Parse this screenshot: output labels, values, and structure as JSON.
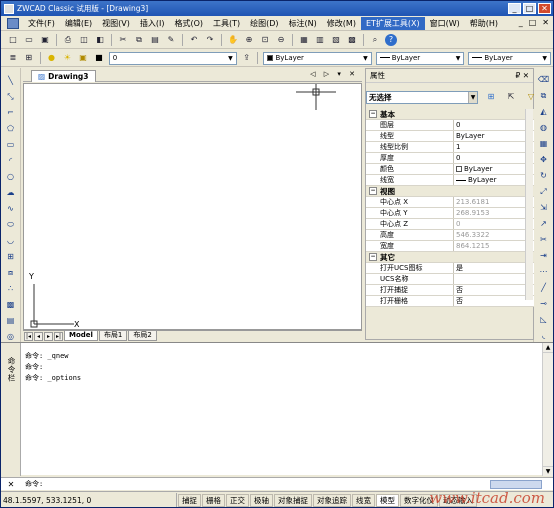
{
  "title": {
    "text": "ZWCAD Classic 试用版 - [Drawing3]",
    "buttons": [
      "_",
      "□",
      "✕"
    ]
  },
  "menubar": {
    "items": [
      {
        "label": "文件(F)"
      },
      {
        "label": "编辑(E)"
      },
      {
        "label": "视图(V)"
      },
      {
        "label": "插入(I)"
      },
      {
        "label": "格式(O)"
      },
      {
        "label": "工具(T)"
      },
      {
        "label": "绘图(D)"
      },
      {
        "label": "标注(N)"
      },
      {
        "label": "修改(M)"
      },
      {
        "label": "ET扩展工具(X)",
        "highlighted": true
      },
      {
        "label": "窗口(W)"
      },
      {
        "label": "帮助(H)"
      }
    ],
    "doc_controls": [
      "_",
      "□",
      "✕"
    ]
  },
  "toolbar2": {
    "layer_value": "0",
    "color_value": "ByLayer",
    "linetype_value": "ByLayer",
    "lineweight_value": "ByLayer"
  },
  "document": {
    "tab_label": "Drawing3",
    "tab_controls": "◁ ▷ ▾ ✕",
    "layout_tabs": [
      "Model",
      "布局1",
      "布局2"
    ],
    "ucs_x_label": "X",
    "ucs_y_label": "Y"
  },
  "properties": {
    "title": "属性",
    "header_controls": "₽ ✕",
    "selection": "无选择",
    "categories": [
      {
        "name": "基本",
        "rows": [
          {
            "key": "图层",
            "value": "0"
          },
          {
            "key": "线型",
            "value": "ByLayer"
          },
          {
            "key": "线型比例",
            "value": "1"
          },
          {
            "key": "厚度",
            "value": "0"
          },
          {
            "key": "颜色",
            "value": "ByLayer",
            "swatch": true
          },
          {
            "key": "线宽",
            "value": "ByLayer",
            "line": true
          }
        ]
      },
      {
        "name": "视图",
        "rows": [
          {
            "key": "中心点 X",
            "value": "213.6181",
            "gray": true
          },
          {
            "key": "中心点 Y",
            "value": "268.9153",
            "gray": true
          },
          {
            "key": "中心点 Z",
            "value": "0",
            "gray": true
          },
          {
            "key": "高度",
            "value": "546.3322",
            "gray": true
          },
          {
            "key": "宽度",
            "value": "864.1215",
            "gray": true
          }
        ]
      },
      {
        "name": "其它",
        "rows": [
          {
            "key": "打开UCS图标",
            "value": "是"
          },
          {
            "key": "UCS名称",
            "value": ""
          },
          {
            "key": "打开捕捉",
            "value": "否"
          },
          {
            "key": "打开栅格",
            "value": "否"
          }
        ]
      }
    ]
  },
  "command": {
    "side_label": "命令栏",
    "history": [
      "命令: _qnew",
      "命令:",
      "命令: _options"
    ],
    "prompt": "命令:"
  },
  "status": {
    "coords": "48.1.5597, 533.1251, 0",
    "buttons": [
      {
        "label": "捕捉",
        "on": false
      },
      {
        "label": "栅格",
        "on": false
      },
      {
        "label": "正交",
        "on": false
      },
      {
        "label": "极轴",
        "on": false
      },
      {
        "label": "对象捕捉",
        "on": false
      },
      {
        "label": "对象追踪",
        "on": false
      },
      {
        "label": "线宽",
        "on": false
      },
      {
        "label": "模型",
        "on": true
      },
      {
        "label": "数字化仪",
        "on": false
      },
      {
        "label": "动态输入",
        "on": false
      }
    ],
    "watermark": "www.itcad.com"
  },
  "colors": {
    "titlebar": "#1f54b3",
    "menu_highlight": "#316ac5",
    "chrome": "#ece9d8",
    "watermark": "#c8432e"
  }
}
